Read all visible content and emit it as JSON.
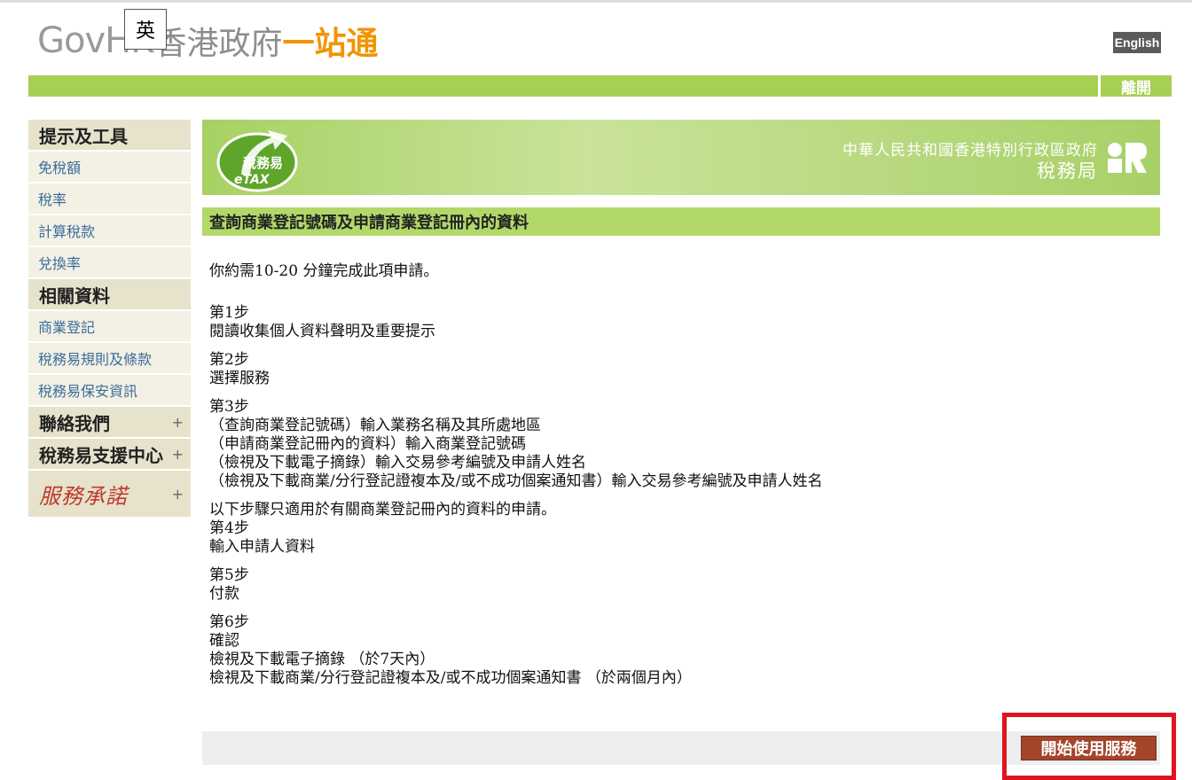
{
  "header": {
    "logo_gov": "GovHK",
    "logo_hk": "香港政府",
    "logo_one": "一站通",
    "ime_indicator": "英",
    "english_label": "English",
    "exit_label": "離開"
  },
  "sidebar": {
    "tips_heading": "提示及工具",
    "tips_items": [
      "免稅額",
      "稅率",
      "計算稅款",
      "兌換率"
    ],
    "related_heading": "相關資料",
    "related_items": [
      "商業登記",
      "稅務易規則及條款",
      "稅務易保安資訊"
    ],
    "contact_label": "聯絡我們",
    "support_label": "稅務易支援中心",
    "promise_label": "服務承諾",
    "expand_symbol": "+"
  },
  "banner": {
    "etax_cn": "稅務易",
    "etax_en": "eTAX",
    "gov_name": "中華人民共和國香港特別行政區政府",
    "dept_name": "稅務局"
  },
  "page": {
    "title": "查詢商業登記號碼及申請商業登記冊內的資料",
    "intro": "你約需10-20 分鐘完成此項申請。",
    "steps_a": [
      {
        "label": "第1步",
        "lines": [
          "閱讀收集個人資料聲明及重要提示"
        ]
      },
      {
        "label": "第2步",
        "lines": [
          "選擇服務"
        ]
      },
      {
        "label": "第3步",
        "lines": [
          "（查詢商業登記號碼）輸入業務名稱及其所處地區",
          "（申請商業登記冊內的資料）輸入商業登記號碼",
          "（檢視及下載電子摘錄）輸入交易參考編號及申請人姓名",
          "（檢視及下載商業/分行登記證複本及/或不成功個案通知書）輸入交易參考編號及申請人姓名"
        ]
      }
    ],
    "note": "以下步驟只適用於有關商業登記冊內的資料的申請。",
    "steps_b": [
      {
        "label": "第4步",
        "lines": [
          "輸入申請人資料"
        ]
      },
      {
        "label": "第5步",
        "lines": [
          "付款"
        ]
      },
      {
        "label": "第6步",
        "lines": [
          "確認",
          "檢視及下載電子摘錄 （於7天內）",
          "檢視及下載商業/分行登記證複本及/或不成功個案通知書 （於兩個月內）"
        ]
      }
    ],
    "start_button": "開始使用服務"
  },
  "colors": {
    "green_bar": "#a6cf54",
    "title_bar": "#b3d86a",
    "start_button": "#a4442b",
    "highlight": "#e0141e",
    "link": "#3b6b9c"
  }
}
